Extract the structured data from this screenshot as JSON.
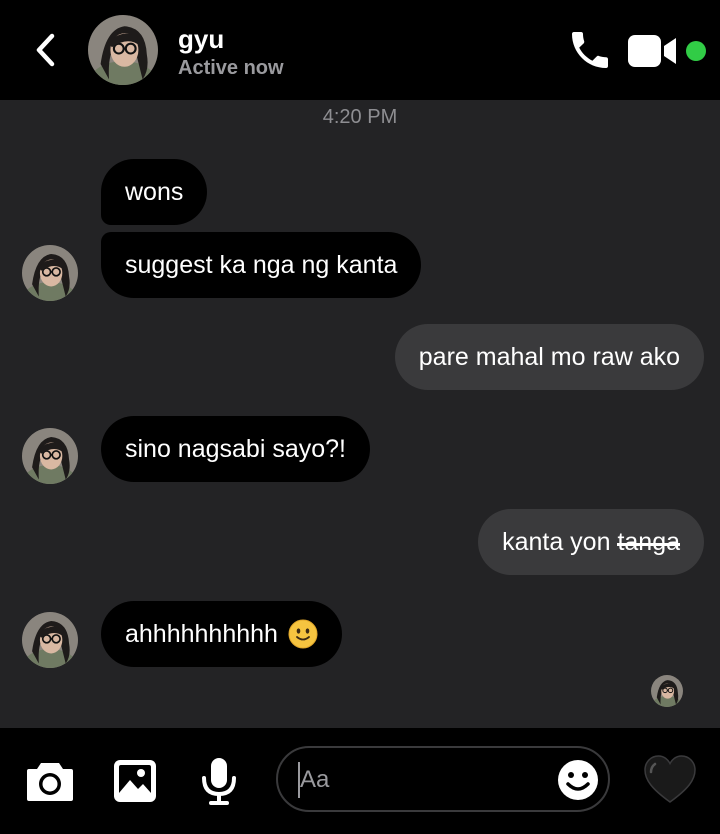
{
  "header": {
    "contact_name": "gyu",
    "status": "Active now",
    "online_color": "#31cc46"
  },
  "conversation": {
    "timestamp": "4:20 PM",
    "messages": [
      {
        "from": "contact",
        "text": "wons"
      },
      {
        "from": "contact",
        "text": "suggest ka nga ng kanta"
      },
      {
        "from": "me",
        "text": "pare mahal mo raw ako"
      },
      {
        "from": "contact",
        "text": "sino nagsabi sayo?!"
      },
      {
        "from": "me",
        "text": "kanta yon",
        "struck_text": "tanga"
      },
      {
        "from": "contact",
        "text": "ahhhhhhhhhh",
        "emoji": "slightly-smiling-face"
      }
    ]
  },
  "composer": {
    "placeholder": "Aa",
    "icons": [
      "camera-icon",
      "gallery-icon",
      "microphone-icon",
      "emoji-icon",
      "heart-icon"
    ]
  },
  "colors": {
    "background": "#232325",
    "incoming_bubble": "#000000",
    "outgoing_bubble": "#3a3a3c",
    "header": "#000000"
  }
}
